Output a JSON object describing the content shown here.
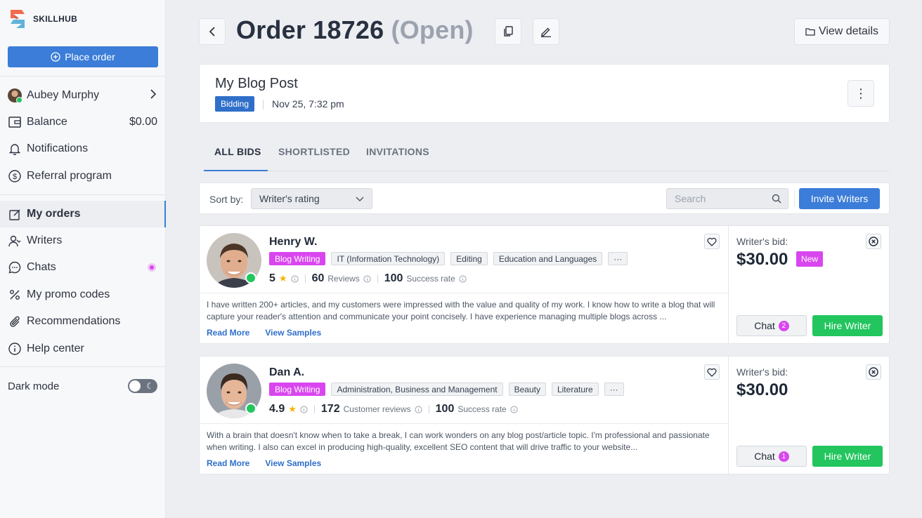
{
  "brand": {
    "name": "SKILLHUB"
  },
  "sidebar": {
    "place_order": "Place order",
    "user": {
      "name": "Aubey Murphy"
    },
    "balance": {
      "label": "Balance",
      "value": "$0.00"
    },
    "notifications": "Notifications",
    "referral": "Referral program",
    "my_orders": "My orders",
    "writers": "Writers",
    "chats": "Chats",
    "promo_codes": "My promo codes",
    "recommendations": "Recommendations",
    "help_center": "Help center",
    "dark_mode": {
      "label": "Dark mode",
      "enabled": false
    }
  },
  "header": {
    "title": "Order 18726",
    "status": "(Open)",
    "view_details": "View details"
  },
  "order": {
    "name": "My Blog Post",
    "badge": "Bidding",
    "date": "Nov 25, 7:32 pm"
  },
  "tabs": [
    {
      "label": "ALL BIDS",
      "active": true
    },
    {
      "label": "SHORTLISTED",
      "active": false
    },
    {
      "label": "INVITATIONS",
      "active": false
    }
  ],
  "filter": {
    "sort_label": "Sort by:",
    "sort_value": "Writer's rating",
    "search_placeholder": "Search",
    "invite_label": "Invite Writers"
  },
  "bids": [
    {
      "name": "Henry W.",
      "tags": [
        "Blog Writing",
        "IT (Information Technology)",
        "Editing",
        "Education and Languages"
      ],
      "more": "···",
      "rating": "5",
      "reviews": "60",
      "reviews_label": "Reviews",
      "success": "100",
      "success_label": "Success rate",
      "bio": "I have written 200+ articles, and my customers were impressed with the value and quality of my work. I know how to write a blog that will capture your reader's attention and communicate your point concisely. I have experience managing multiple blogs across ...",
      "read_more": "Read More",
      "view_samples": "View Samples",
      "bid_label": "Writer's bid:",
      "bid_amount": "$30.00",
      "new_badge": "New",
      "chat_label": "Chat",
      "chat_count": "2",
      "hire_label": "Hire Writer"
    },
    {
      "name": "Dan A.",
      "tags": [
        "Blog Writing",
        "Administration, Business and Management",
        "Beauty",
        "Literature"
      ],
      "more": "···",
      "rating": "4.9",
      "reviews": "172",
      "reviews_label": "Customer reviews",
      "success": "100",
      "success_label": "Success rate",
      "bio": "With a brain that doesn't know when to take a break, I can work wonders on any blog post/article topic. I'm professional and passionate when writing. I also can excel in producing high-quality, excellent SEO content that will drive traffic to your website...",
      "read_more": "Read More",
      "view_samples": "View Samples",
      "bid_label": "Writer's bid:",
      "bid_amount": "$30.00",
      "chat_label": "Chat",
      "chat_count": "1",
      "hire_label": "Hire Writer"
    }
  ],
  "colors": {
    "accent": "#3b7dd8",
    "tag_primary": "#d946ef",
    "hire": "#22c55e",
    "online": "#22c55e",
    "star": "#f5b301"
  }
}
